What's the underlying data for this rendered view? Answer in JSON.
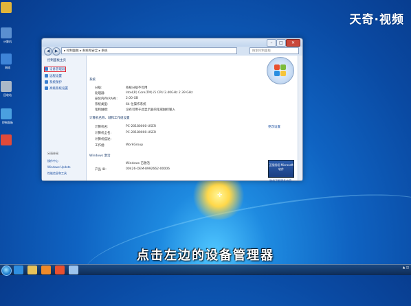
{
  "watermark": "天奇·视频",
  "subtitle": "点击左边的设备管理器",
  "desktop_icons": [
    {
      "label": "",
      "color": "#e0b43a"
    },
    {
      "label": "计算机",
      "color": "#5a8fd0"
    },
    {
      "label": "网络",
      "color": "#3e84d8"
    },
    {
      "label": "回收站",
      "color": "#aab8c8"
    },
    {
      "label": "控制面板",
      "color": "#4aa0e0"
    },
    {
      "label": "",
      "color": "#e04a3a"
    }
  ],
  "window": {
    "address": "▸ 控制面板 ▸ 系统和安全 ▸ 系统",
    "search_placeholder": "搜索控制面板",
    "left_pane": {
      "home": "控制面板主页",
      "items": [
        "设备管理器",
        "远程设置",
        "系统保护",
        "高级系统设置"
      ],
      "see_also_head": "另请参阅",
      "see_also": [
        "操作中心",
        "Windows Update",
        "性能信息和工具"
      ]
    },
    "sections": {
      "system": "系统",
      "computer": "计算机名称、域和工作组设置",
      "activation": "Windows 激活"
    },
    "system_rows": [
      {
        "label": "分级:",
        "value": "系统分级不可用"
      },
      {
        "label": "处理器:",
        "value": "Intel(R) Core(TM) i5 CPU 2.40GHz 2.39 GHz"
      },
      {
        "label": "安装内存(RAM):",
        "value": "2.00 GB"
      },
      {
        "label": "系统类型:",
        "value": "64 位操作系统"
      },
      {
        "label": "笔和触摸:",
        "value": "没有可用于此显示器的笔或触控输入"
      }
    ],
    "computer_rows": [
      {
        "label": "计算机名:",
        "value": "PC-20180000-USER"
      },
      {
        "label": "计算机全名:",
        "value": "PC-20180000-USER"
      },
      {
        "label": "计算机描述:",
        "value": ""
      },
      {
        "label": "工作组:",
        "value": "WorkGroup"
      }
    ],
    "change_settings": "更改设置",
    "activation_rows": [
      {
        "label": "",
        "value": "Windows 已激活"
      },
      {
        "label": "产品 ID:",
        "value": "00426-OEM-8992662-00006"
      }
    ],
    "genuine_badge": "正版授权 Microsoft 软件",
    "genuine_link": "联机了解更多内容..."
  },
  "taskbar": {
    "buttons": [
      {
        "name": "ie",
        "color": "#2f8ee0"
      },
      {
        "name": "folder",
        "color": "#e8c25a"
      },
      {
        "name": "media",
        "color": "#f08a2a"
      },
      {
        "name": "app",
        "color": "#e85030"
      },
      {
        "name": "control-panel",
        "color": "#9cc4ee"
      }
    ]
  }
}
